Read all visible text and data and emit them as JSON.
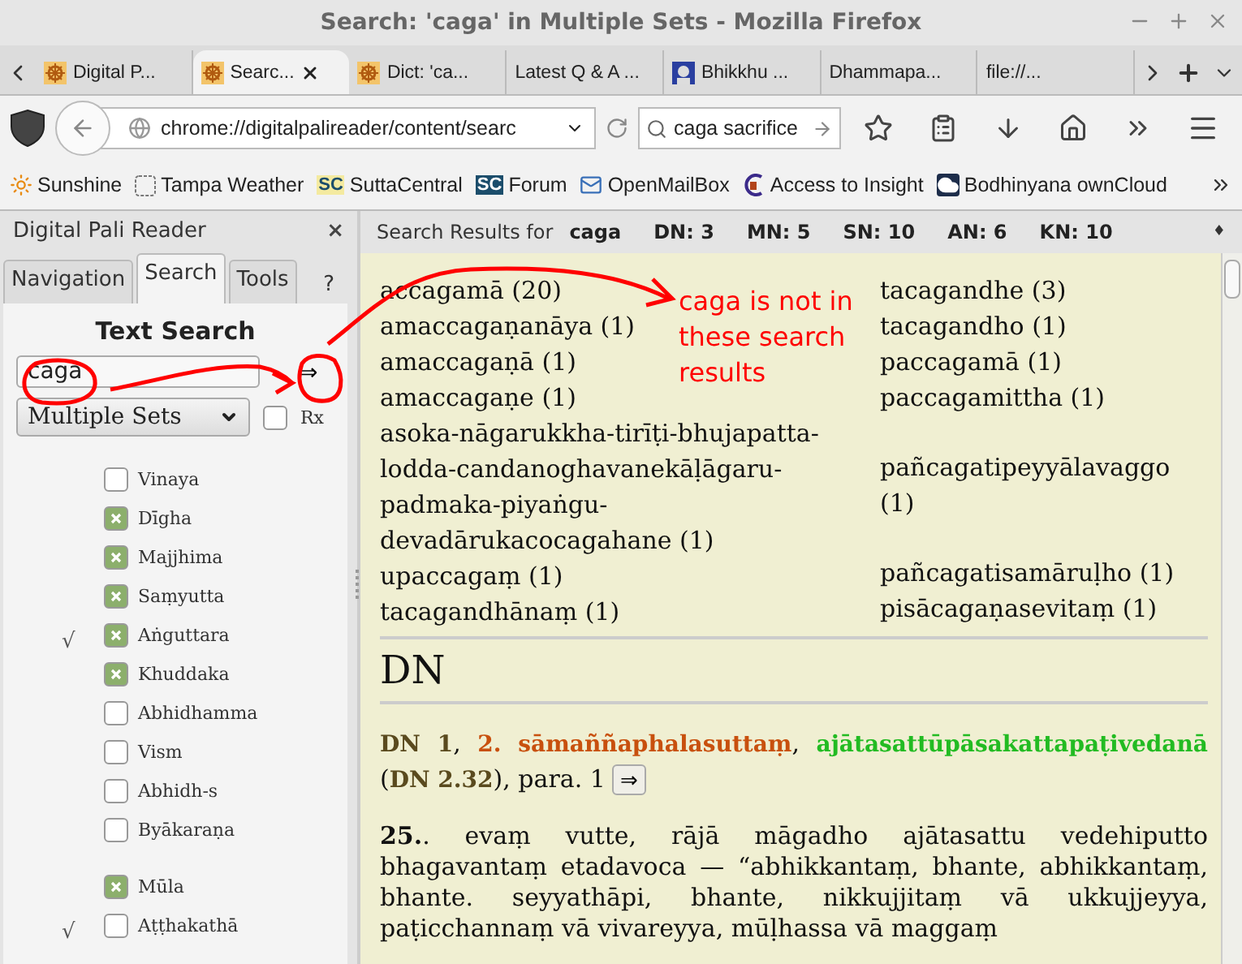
{
  "window": {
    "title": "Search: 'caga' in Multiple Sets - Mozilla Firefox"
  },
  "browser_tabs": [
    {
      "label": "Digital P...",
      "kind": "wheel",
      "selected": false
    },
    {
      "label": "Searc...",
      "kind": "wheel",
      "selected": true
    },
    {
      "label": "Dict: 'ca...",
      "kind": "wheel",
      "selected": false
    },
    {
      "label": "Latest Q & A ...",
      "kind": "plain",
      "selected": false
    },
    {
      "label": "Bhikkhu ...",
      "kind": "portrait",
      "selected": false
    },
    {
      "label": "Dhammapa...",
      "kind": "plain",
      "selected": false
    },
    {
      "label": "file://...",
      "kind": "plain",
      "selected": false
    }
  ],
  "address_bar": {
    "url": "chrome://digitalpalireader/content/searc"
  },
  "search_bar": {
    "value": "caga sacrifice"
  },
  "bookmarks": [
    {
      "label": "Sunshine",
      "kind": "sun"
    },
    {
      "label": "Tampa Weather",
      "kind": "blank"
    },
    {
      "label": "SuttaCentral",
      "kind": "badge",
      "badge": "SC"
    },
    {
      "label": "Forum",
      "kind": "badge-dark",
      "badge": "SC"
    },
    {
      "label": "OpenMailBox",
      "kind": "mail"
    },
    {
      "label": "Access to Insight",
      "kind": "insight"
    },
    {
      "label": "Bodhinyana ownCloud",
      "kind": "cloud"
    }
  ],
  "sidebar": {
    "title": "Digital Pali Reader",
    "close": "×",
    "tabs": [
      {
        "label": "Navigation",
        "selected": false
      },
      {
        "label": "Search",
        "selected": true
      },
      {
        "label": "Tools",
        "selected": false
      }
    ],
    "help": "?",
    "heading": "Text Search",
    "query": {
      "value": "caga"
    },
    "go_button": "⇒",
    "set_select": {
      "value": "Multiple Sets"
    },
    "regex": {
      "label": "Rx",
      "checked": false
    },
    "groups": [
      {
        "items": [
          {
            "label": "Vinaya",
            "checked": false
          },
          {
            "label": "Dīgha",
            "checked": true
          },
          {
            "label": "Majjhima",
            "checked": true
          },
          {
            "label": "Saṃyutta",
            "checked": true
          },
          {
            "label": "Aṅguttara",
            "checked": true,
            "tick": "√"
          },
          {
            "label": "Khuddaka",
            "checked": true
          },
          {
            "label": "Abhidhamma",
            "checked": false
          },
          {
            "label": "Vism",
            "checked": false
          },
          {
            "label": "Abhidh-s",
            "checked": false
          },
          {
            "label": "Byākaraṇa",
            "checked": false
          }
        ]
      },
      {
        "items": [
          {
            "label": "Mūla",
            "checked": true
          },
          {
            "label": "Aṭṭhakathā",
            "checked": false,
            "tick": "√"
          }
        ]
      }
    ]
  },
  "results": {
    "header": {
      "label": "Search Results for",
      "term": "caga",
      "counts": [
        "DN: 3",
        "MN: 5",
        "SN: 10",
        "AN: 6",
        "KN: 10"
      ],
      "toggle": "♦"
    },
    "words_left": [
      "accagamā (20)",
      "amaccagaṇanāya (1)",
      "amaccagaṇā (1)",
      "amaccagaṇe (1)",
      "asoka-nāgarukkha-tirīṭi-bhujapatta-lodda-candanoghavanekāḷāgaru-padmaka-piyaṅgu-devadārukacocagahane (1)",
      "upaccagaṃ (1)",
      "tacagandhānaṃ (1)"
    ],
    "words_right": [
      "tacagandhe (3)",
      "tacagandho (1)",
      "paccagamā (1)",
      "paccagamittha (1)",
      "pañcagatipeyyālavaggo (1)",
      "pañcagatisamāruḷho (1)",
      "pisācagaṇasevitaṃ (1)"
    ],
    "section": "DN",
    "citation": [
      {
        "text": "DN",
        "kind": "nikaya"
      },
      {
        "text": " 1",
        "kind": "nikaya"
      },
      {
        "text": ", ",
        "kind": "plain"
      },
      {
        "text": "2. sāmaññaphalasuttaṃ",
        "kind": "sutta"
      },
      {
        "text": ", ",
        "kind": "plain"
      },
      {
        "text": "ajātasattūpāsakattapaṭivedanā",
        "kind": "section"
      },
      {
        "text": " (",
        "kind": "plain"
      },
      {
        "text": "DN 2.32",
        "kind": "nikaya"
      },
      {
        "text": "), para. 1",
        "kind": "plain"
      }
    ],
    "open_button": "⇒",
    "paragraph": "**25.**. evaṃ vutte, rājā māgadho ajātasattu vedehiputto bhagavantaṃ etadavoca — “abhikkantaṃ, bhante, abhikkantaṃ, bhante. seyyathāpi, bhante, nikkujjitaṃ vā ukkujjeyya, paṭicchannaṃ vā vivareyya, mūḷhassa vā maggaṃ"
  },
  "annotation": {
    "note": "caga is not in these search results"
  }
}
